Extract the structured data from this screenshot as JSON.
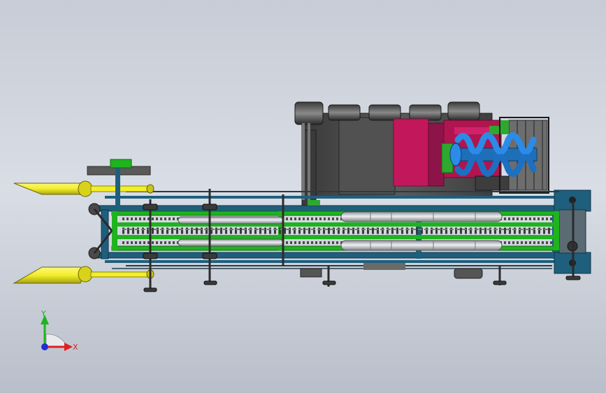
{
  "viewport": {
    "background_top": "#c7ccd6",
    "background_bottom": "#b9bfca"
  },
  "colors": {
    "frame_blue": "#1f5f7e",
    "frame_green": "#1fb31f",
    "chassis_grey": "#4a4a4a",
    "chassis_dark": "#2b2b2b",
    "hopper_magenta": "#c2185b",
    "auger_blue": "#2b8be8",
    "divider_yellow": "#f2ee2a",
    "roller_silver": "#cfd3d6"
  },
  "triad": {
    "x_label": "X",
    "y_label": "Y",
    "x_color": "#e02020",
    "y_color": "#1fb31f",
    "z_color": "#1f2fd6"
  },
  "model_parts": [
    "engine-block",
    "grain-hopper",
    "screw-auger",
    "header-frame",
    "crop-dividers",
    "conveyor-chain",
    "threshing-rollers",
    "rear-bearing-plate"
  ]
}
